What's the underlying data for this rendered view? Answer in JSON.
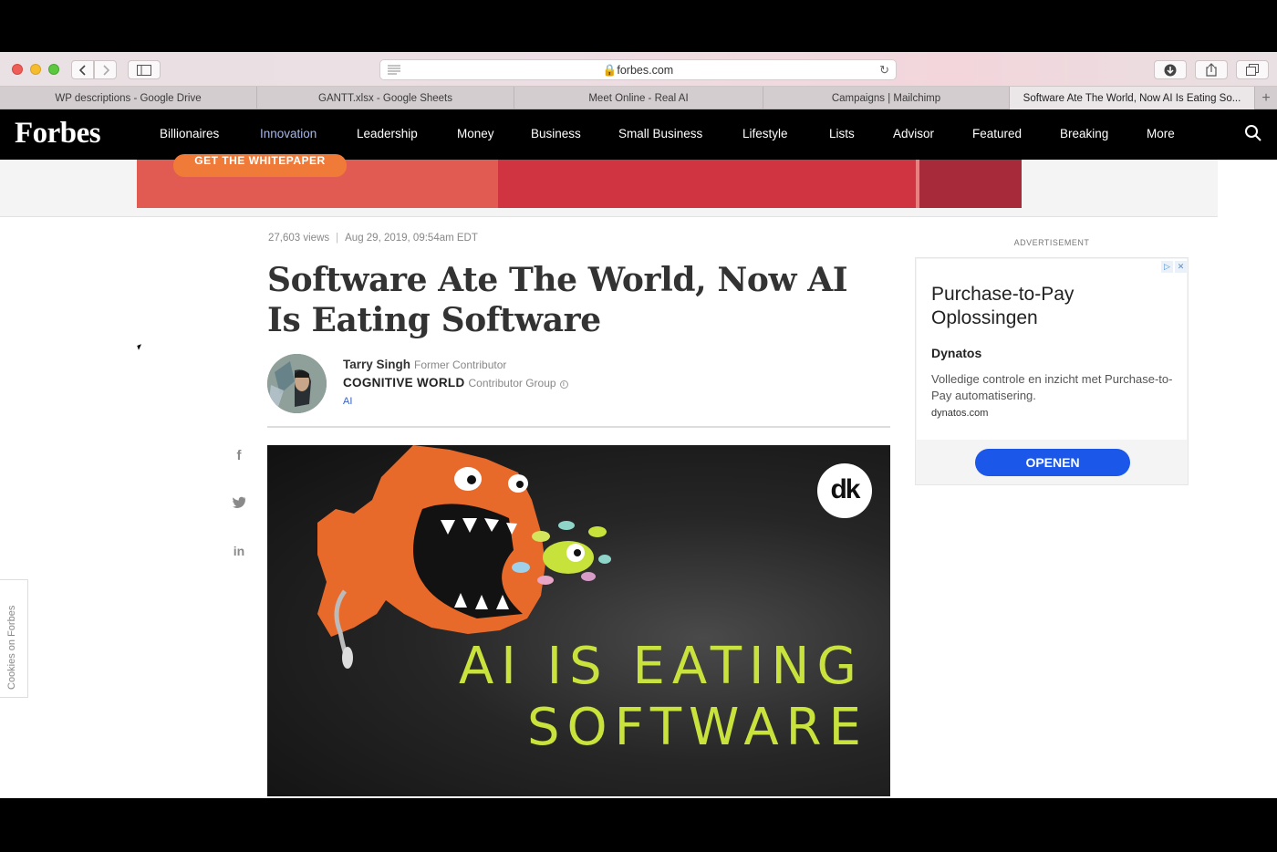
{
  "browser": {
    "address": "forbes.com",
    "tabs": [
      {
        "label": "WP descriptions - Google Drive"
      },
      {
        "label": "GANTT.xlsx - Google Sheets"
      },
      {
        "label": "Meet Online - Real AI"
      },
      {
        "label": "Campaigns | Mailchimp"
      },
      {
        "label": "Software Ate The World, Now AI Is Eating So..."
      }
    ],
    "new_tab": "+"
  },
  "site": {
    "logo": "Forbes",
    "nav": [
      "Billionaires",
      "Innovation",
      "Leadership",
      "Money",
      "Business",
      "Small Business",
      "Lifestyle",
      "Lists",
      "Advisor",
      "Featured",
      "Breaking",
      "More"
    ],
    "active_nav": "Innovation"
  },
  "top_banner": {
    "button": "GET THE WHITEPAPER"
  },
  "article": {
    "views": "27,603 views",
    "separator": "|",
    "date": "Aug 29, 2019, 09:54am EDT",
    "title": "Software Ate The World, Now AI Is Eating Software",
    "author": "Tarry Singh",
    "author_role": "Former Contributor",
    "group": "COGNITIVE WORLD",
    "group_role": "Contributor Group",
    "topic": "AI",
    "hero_line1": "AI IS EATING",
    "hero_line2": "SOFTWARE",
    "hero_logo": "dk"
  },
  "share": {
    "facebook": "f",
    "twitter": "twitter-icon",
    "linkedin": "in"
  },
  "sidebar_ad": {
    "label": "ADVERTISEMENT",
    "title": "Purchase-to-Pay Oplossingen",
    "brand": "Dynatos",
    "description": "Volledige controle en inzicht met Purchase-to-Pay automatisering.",
    "domain": "dynatos.com",
    "cta": "OPENEN"
  },
  "cookie_tab": "Cookies on Forbes",
  "colors": {
    "nav_bg": "#000000",
    "nav_active": "#a7b7e6",
    "hero_text": "#c9e23c",
    "cta_blue": "#1b57e8",
    "link_blue": "#385fc0"
  }
}
